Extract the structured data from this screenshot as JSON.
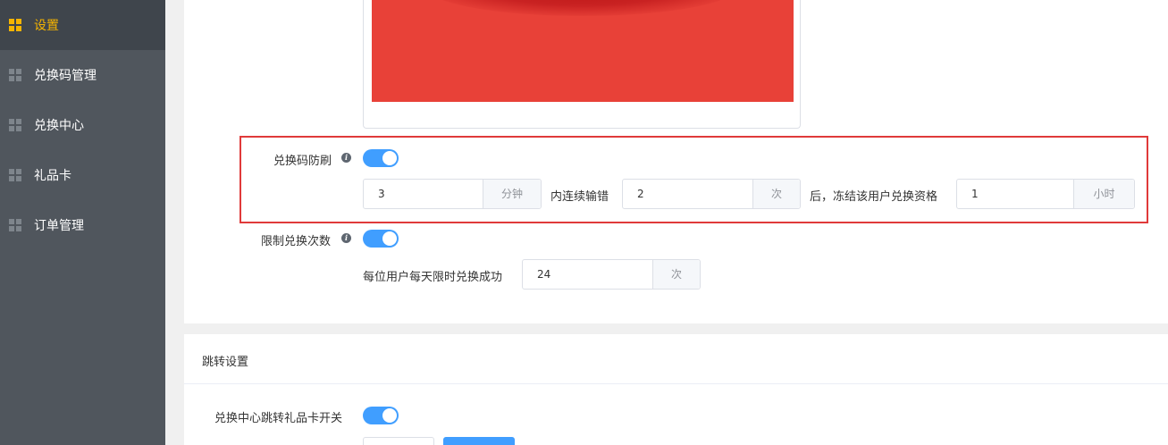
{
  "sidebar": {
    "items": [
      {
        "label": "设置",
        "active": true
      },
      {
        "label": "兑换码管理",
        "active": false
      },
      {
        "label": "兑换中心",
        "active": false
      },
      {
        "label": "礼品卡",
        "active": false
      },
      {
        "label": "订单管理",
        "active": false
      }
    ]
  },
  "anti_brush": {
    "label": "兑换码防刷",
    "enabled": true,
    "minutes_value": "3",
    "minutes_unit": "分钟",
    "text_within": "内连续输错",
    "times_value": "2",
    "times_unit": "次",
    "text_after": "后，冻结该用户兑换资格",
    "hours_value": "1",
    "hours_unit": "小时"
  },
  "limit_times": {
    "label": "限制兑换次数",
    "enabled": true,
    "text_per_user": "每位用户每天限时兑换成功",
    "value": "24",
    "unit": "次"
  },
  "redirect_section": {
    "title": "跳转设置",
    "switch_label": "兑换中心跳转礼品卡开关",
    "enabled": true
  },
  "colors": {
    "accent": "#409eff",
    "sidebar_bg": "#50565d",
    "active_text": "#f5b400",
    "highlight": "#e03a3a",
    "preview_red": "#e84138"
  }
}
